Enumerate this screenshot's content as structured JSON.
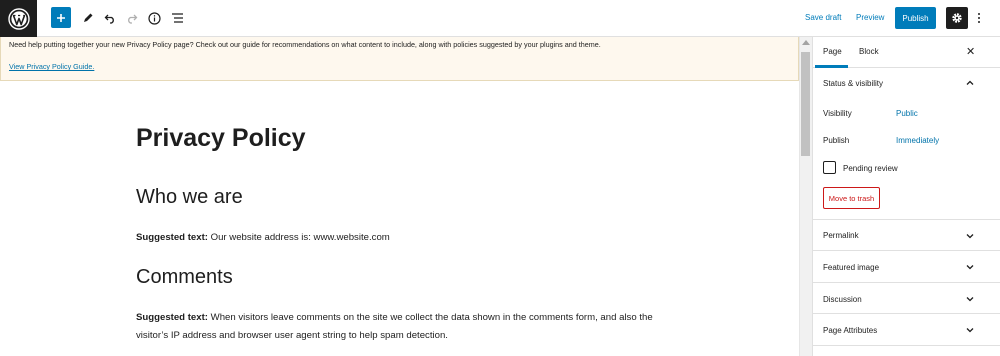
{
  "toolbar": {
    "logo_icon": "wordpress-logo-icon",
    "add_icon": "plus-icon",
    "tools_icon": "pencil-icon",
    "undo_icon": "undo-icon",
    "redo_icon": "redo-icon",
    "info_icon": "info-icon",
    "outline_icon": "list-view-icon",
    "save_draft_label": "Save draft",
    "preview_label": "Preview",
    "publish_label": "Publish",
    "settings_icon": "gear-icon",
    "more_icon": "more-vertical-icon"
  },
  "notice": {
    "text": "Need help putting together your new Privacy Policy page? Check out our guide for recommendations on what content to include, along with policies suggested by your plugins and theme.",
    "link_label": "View Privacy Policy Guide."
  },
  "document": {
    "title": "Privacy Policy",
    "sections": [
      {
        "heading": "Who we are",
        "bold": "Suggested text:",
        "text": " Our website address is: www.website.com"
      },
      {
        "heading": "Comments",
        "bold": "Suggested text:",
        "text": " When visitors leave comments on the site we collect the data shown in the comments form, and also the visitor’s IP address and browser user agent string to help spam detection."
      }
    ]
  },
  "sidebar": {
    "tabs": [
      "Page",
      "Block"
    ],
    "active_tab": "Page",
    "close_icon": "close-icon",
    "status_panel": {
      "title": "Status & visibility",
      "visibility_label": "Visibility",
      "visibility_value": "Public",
      "publish_label": "Publish",
      "publish_value": "Immediately",
      "pending_label": "Pending review",
      "pending_checked": false,
      "trash_label": "Move to trash"
    },
    "panels": [
      "Permalink",
      "Featured image",
      "Discussion",
      "Page Attributes"
    ]
  },
  "colors": {
    "accent": "#007cba",
    "notice_bg": "#fef8ee",
    "danger": "#cc1818",
    "dark": "#1e1e1e"
  }
}
